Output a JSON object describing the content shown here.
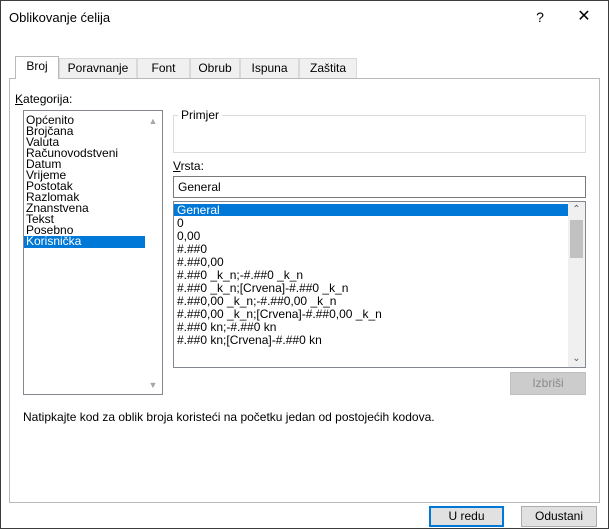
{
  "window": {
    "title": "Oblikovanje ćelija",
    "help_glyph": "?",
    "close_glyph": "✕"
  },
  "tabs": [
    {
      "label": "Broj"
    },
    {
      "label": "Poravnanje"
    },
    {
      "label": "Font"
    },
    {
      "label": "Obrub"
    },
    {
      "label": "Ispuna"
    },
    {
      "label": "Zaštita"
    }
  ],
  "category": {
    "label_underlined": "K",
    "label_rest": "ategorija:",
    "items": [
      "Općenito",
      "Brojčana",
      "Valuta",
      "Računovodstveni",
      "Datum",
      "Vrijeme",
      "Postotak",
      "Razlomak",
      "Znanstvena",
      "Tekst",
      "Posebno",
      "Korisnička"
    ],
    "selected": "Korisnička"
  },
  "sample": {
    "label": "Primjer"
  },
  "type": {
    "label_underlined": "V",
    "label_rest": "rsta:",
    "value": "General"
  },
  "formats": {
    "items": [
      "General",
      "0",
      "0,00",
      "#.##0",
      "#.##0,00",
      "#.##0 _k_n;-#.##0 _k_n",
      "#.##0 _k_n;[Crvena]-#.##0 _k_n",
      "#.##0,00 _k_n;-#.##0,00 _k_n",
      "#.##0,00 _k_n;[Crvena]-#.##0,00 _k_n",
      "#.##0 kn;-#.##0 kn",
      "#.##0 kn;[Crvena]-#.##0 kn"
    ],
    "selected": "General"
  },
  "buttons": {
    "delete": "Izbriši",
    "ok": "U redu",
    "cancel": "Odustani"
  },
  "hint": "Natipkajte kod za oblik broja koristeći na početku jedan od postojećih kodova.",
  "colors": {
    "selection": "#0078d7",
    "default_button_border": "#0078d7"
  }
}
